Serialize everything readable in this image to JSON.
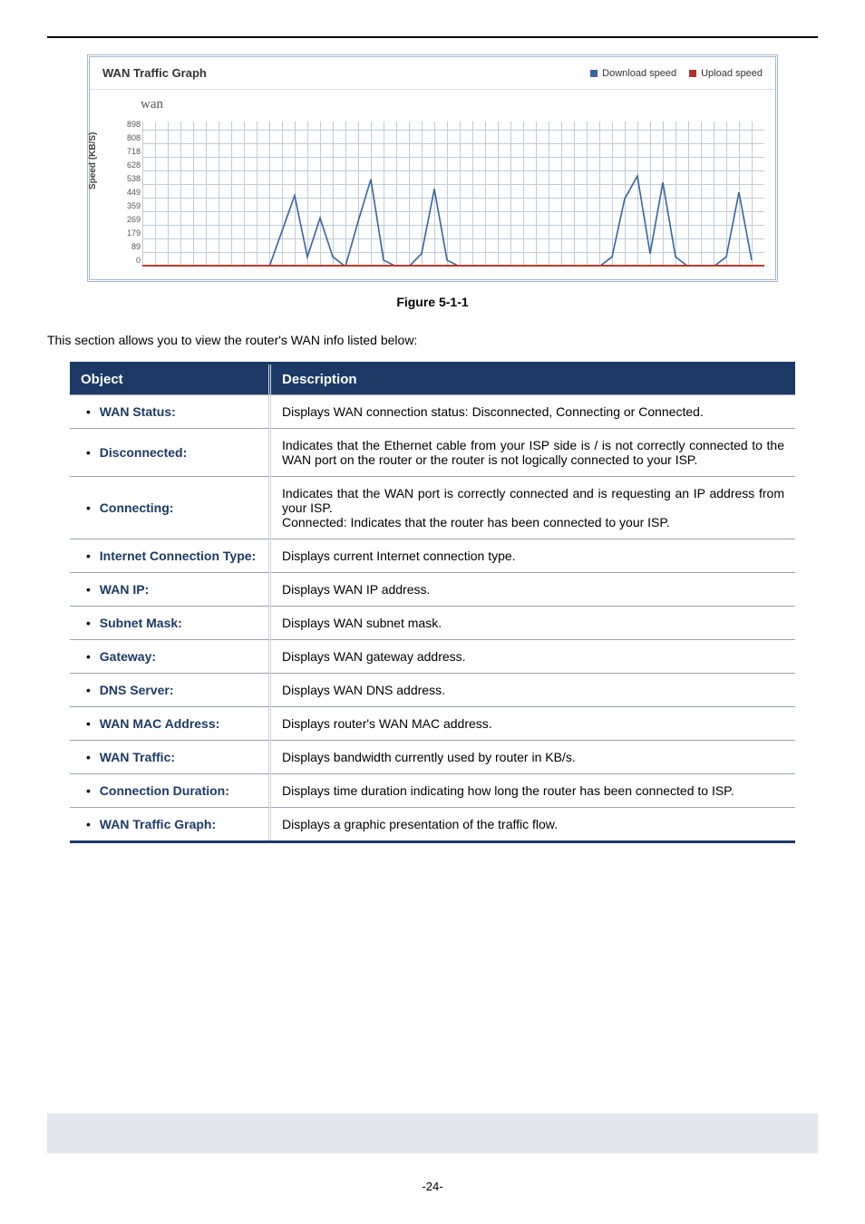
{
  "graph": {
    "title": "WAN Traffic Graph",
    "legend_download": "Download speed",
    "legend_upload": "Upload speed",
    "series_label": "wan",
    "ylabel": "Speed (KB/S)"
  },
  "chart_data": {
    "type": "line",
    "ylabel": "Speed (KB/S)",
    "ylim": [
      0,
      898
    ],
    "yticks": [
      "898",
      "808",
      "718",
      "628",
      "538",
      "449",
      "359",
      "269",
      "179",
      "89",
      "0"
    ],
    "x_count": 50,
    "series": [
      {
        "name": "Download speed",
        "values": [
          0,
          0,
          0,
          0,
          0,
          0,
          0,
          0,
          0,
          0,
          0,
          220,
          440,
          60,
          300,
          60,
          0,
          280,
          540,
          40,
          0,
          0,
          80,
          480,
          40,
          0,
          0,
          0,
          0,
          0,
          0,
          0,
          0,
          0,
          0,
          0,
          0,
          60,
          420,
          560,
          80,
          520,
          60,
          0,
          0,
          0,
          60,
          460,
          40
        ]
      },
      {
        "name": "Upload speed",
        "values": [
          0,
          0,
          0,
          0,
          0,
          0,
          0,
          0,
          0,
          0,
          0,
          0,
          0,
          0,
          0,
          0,
          0,
          0,
          0,
          0,
          0,
          0,
          0,
          0,
          0,
          0,
          0,
          0,
          0,
          0,
          0,
          0,
          0,
          0,
          0,
          0,
          0,
          0,
          0,
          0,
          0,
          0,
          0,
          0,
          0,
          0,
          0,
          0,
          0
        ]
      }
    ],
    "legend": [
      "Download speed",
      "Upload speed"
    ]
  },
  "figure_caption": "Figure 5-1-1",
  "intro": "This section allows you to view the router's WAN info listed below:",
  "table": {
    "headers": {
      "object": "Object",
      "description": "Description"
    },
    "rows": [
      {
        "object": "WAN Status:",
        "description": "Displays WAN connection status: Disconnected, Connecting or Connected."
      },
      {
        "object": "Disconnected:",
        "description": "Indicates that the Ethernet cable from your ISP side is / is not correctly connected to the WAN port on the router or the router is not logically connected to your ISP."
      },
      {
        "object": "Connecting:",
        "description": "Indicates that the WAN port is correctly connected and is requesting an IP address from your ISP.\nConnected: Indicates that the router has been connected to your ISP."
      },
      {
        "object": "Internet Connection Type:",
        "description": "Displays current Internet connection type."
      },
      {
        "object": "WAN IP:",
        "description": "Displays WAN IP address."
      },
      {
        "object": "Subnet Mask:",
        "description": "Displays WAN subnet mask."
      },
      {
        "object": "Gateway:",
        "description": "Displays WAN gateway address."
      },
      {
        "object": "DNS Server:",
        "description": "Displays WAN DNS address."
      },
      {
        "object": "WAN MAC Address:",
        "description": "Displays router's WAN MAC address."
      },
      {
        "object": "WAN Traffic:",
        "description": "Displays bandwidth currently used by router in KB/s."
      },
      {
        "object": "Connection Duration:",
        "description": "Displays time duration indicating how long the router has been connected to ISP."
      },
      {
        "object": "WAN Traffic Graph:",
        "description": "Displays a graphic presentation of the traffic flow."
      }
    ]
  },
  "page_number": "-24-"
}
